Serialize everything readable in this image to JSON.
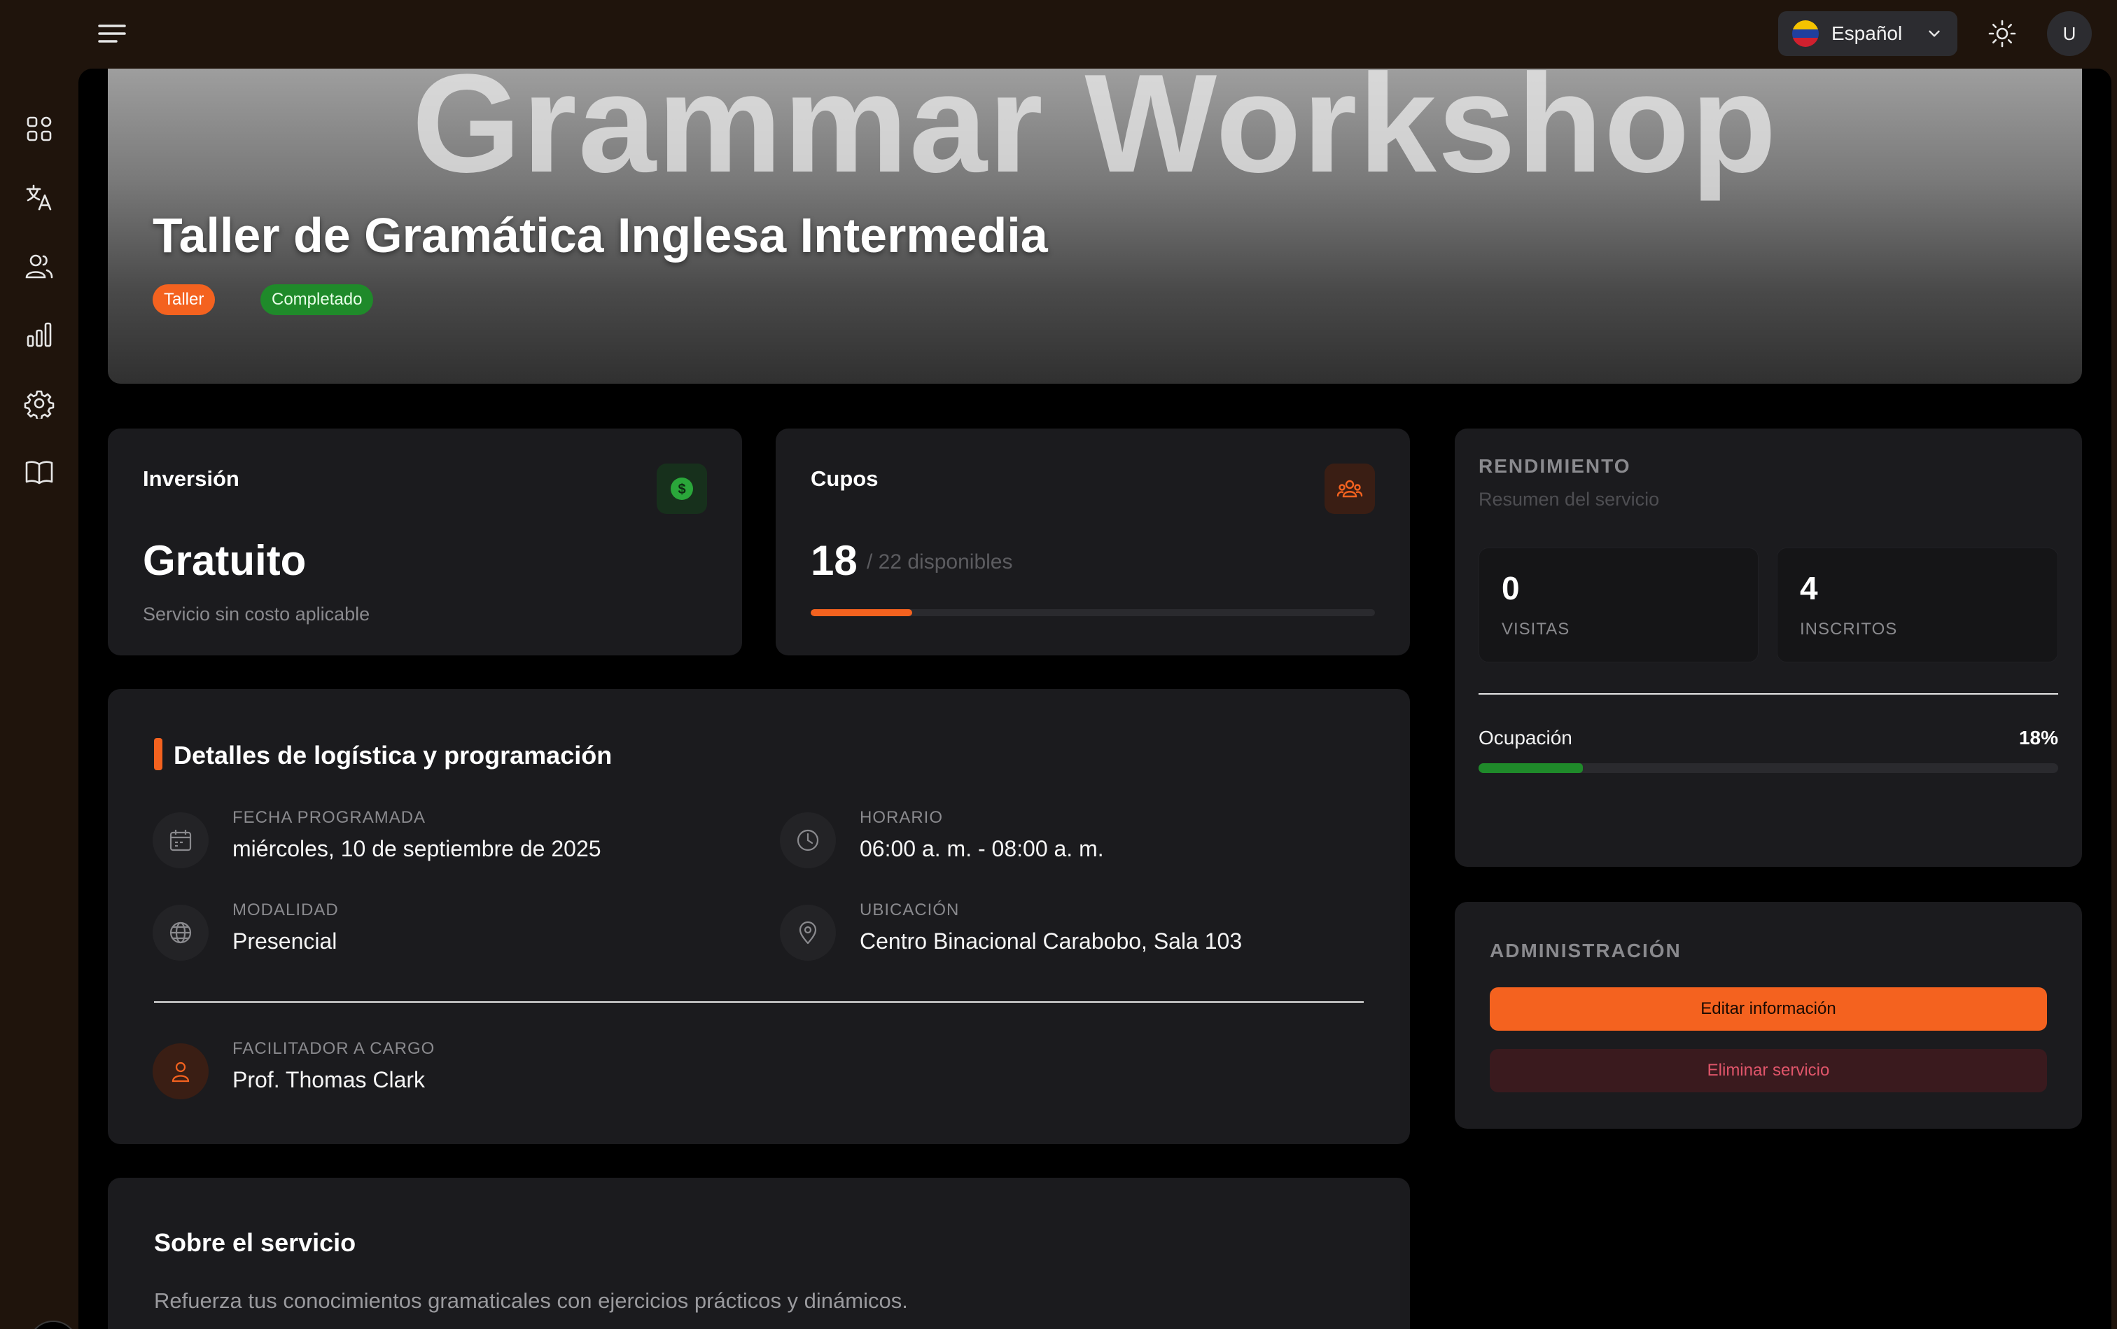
{
  "topbar": {
    "language": "Español",
    "avatar_initial": "U"
  },
  "hero": {
    "image_text": "Grammar Workshop",
    "title": "Taller de Gramática Inglesa Intermedia",
    "tags": {
      "type": "Taller",
      "status": "Completado"
    }
  },
  "investment": {
    "label": "Inversión",
    "value": "Gratuito",
    "note": "Servicio sin costo aplicable"
  },
  "slots": {
    "label": "Cupos",
    "value": "18",
    "note": "/ 22 disponibles",
    "fill_fraction": 0.18
  },
  "logistics": {
    "title": "Detalles de logística y programación",
    "date": {
      "label": "FECHA PROGRAMADA",
      "value": "miércoles, 10 de septiembre de 2025"
    },
    "schedule": {
      "label": "HORARIO",
      "value": "06:00 a. m. - 08:00 a. m."
    },
    "mode": {
      "label": "MODALIDAD",
      "value": "Presencial"
    },
    "location": {
      "label": "UBICACIÓN",
      "value": "Centro Binacional Carabobo, Sala 103"
    },
    "facilitator": {
      "label": "FACILITADOR A CARGO",
      "value": "Prof. Thomas Clark"
    }
  },
  "about": {
    "title": "Sobre el servicio",
    "text": "Refuerza tus conocimientos gramaticales con ejercicios prácticos y dinámicos."
  },
  "performance": {
    "title": "RENDIMIENTO",
    "subtitle": "Resumen del servicio",
    "visits": {
      "value": "0",
      "label": "VISITAS"
    },
    "enrolled": {
      "value": "4",
      "label": "INSCRITOS"
    },
    "occupancy": {
      "label": "Ocupación",
      "value": "18%",
      "fraction": 0.18
    }
  },
  "admin": {
    "title": "ADMINISTRACIÓN",
    "edit_label": "Editar información",
    "delete_label": "Eliminar servicio"
  },
  "colors": {
    "accent": "#f4621f",
    "success": "#1f8a2a",
    "danger_bg": "#3a1a1e",
    "danger_text": "#e0556a"
  }
}
